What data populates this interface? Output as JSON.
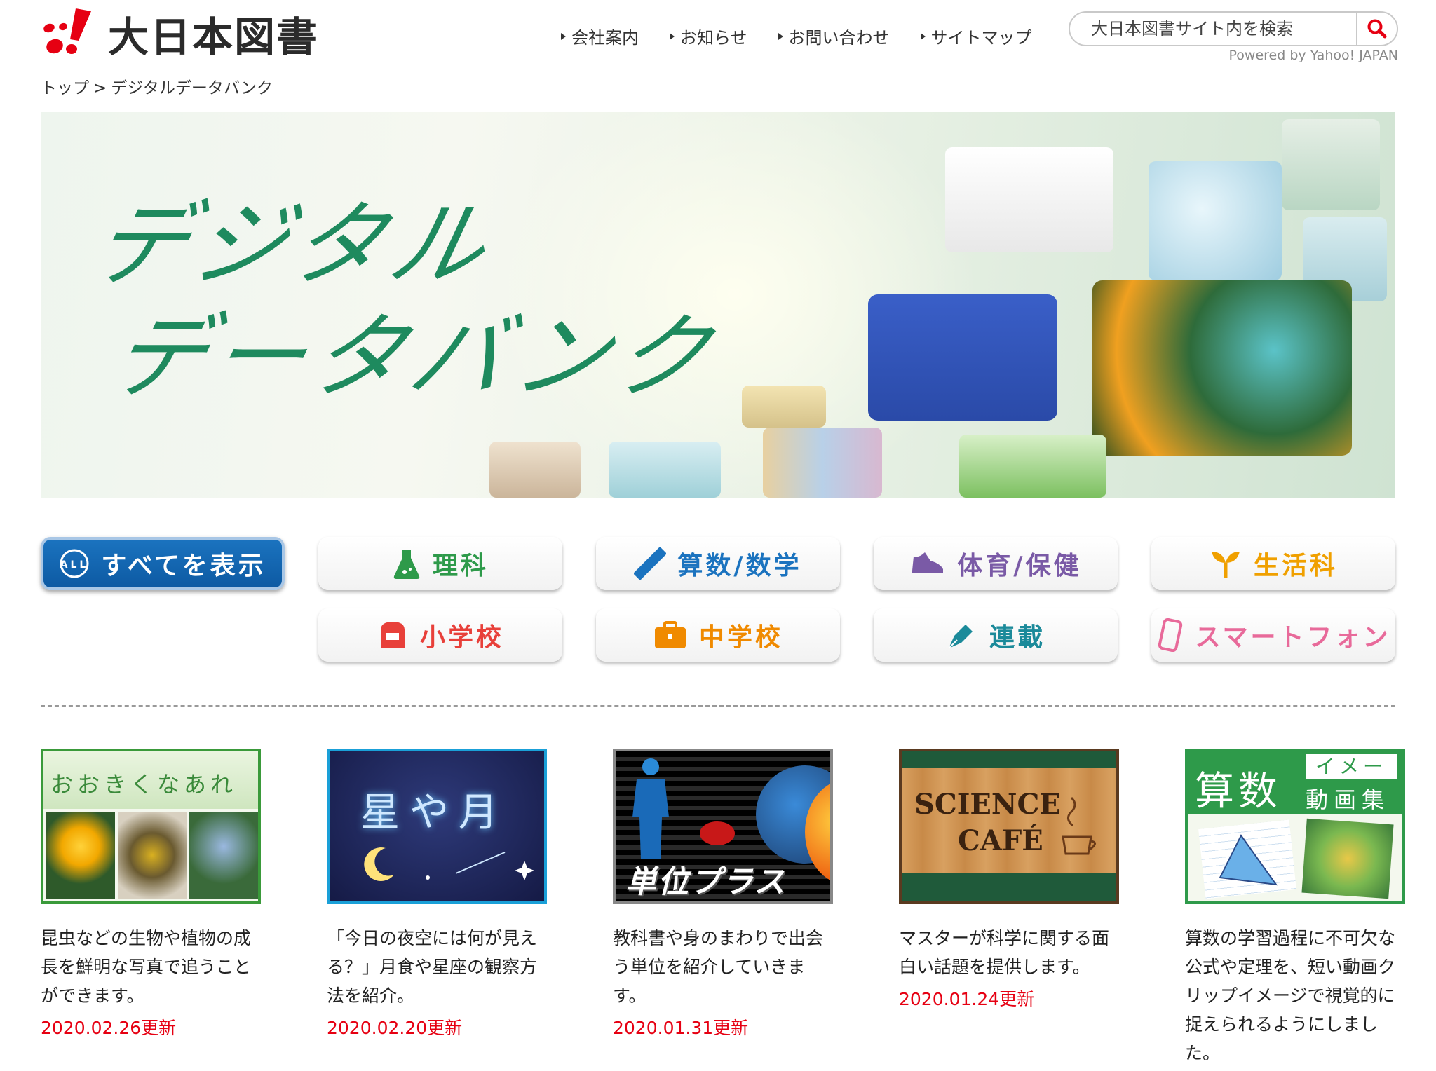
{
  "brand": {
    "name": "大日本図書",
    "color": "#e60012"
  },
  "topnav": [
    {
      "label": "会社案内"
    },
    {
      "label": "お知らせ"
    },
    {
      "label": "お問い合わせ"
    },
    {
      "label": "サイトマップ"
    }
  ],
  "search": {
    "placeholder": "大日本図書サイト内を検索",
    "powered": "Powered by Yahoo! JAPAN"
  },
  "breadcrumb": {
    "home": "トップ",
    "sep": ">",
    "current": "デジタルデータバンク"
  },
  "hero": {
    "line1": "デジタル",
    "line2": "データバンク"
  },
  "categories": [
    {
      "label": "すべてを表示",
      "icon": "all-icon",
      "color": "#0d5aa3"
    },
    {
      "label": "理科",
      "icon": "flask-icon",
      "color": "#2e9a4a"
    },
    {
      "label": "算数/数学",
      "icon": "ruler-icon",
      "color": "#1b73bf"
    },
    {
      "label": "体育/保健",
      "icon": "shoe-icon",
      "color": "#7a5aa6"
    },
    {
      "label": "生活科",
      "icon": "sprout-icon",
      "color": "#f0a000"
    },
    {
      "label": "小学校",
      "icon": "school-bag-icon",
      "color": "#e8403a"
    },
    {
      "label": "中学校",
      "icon": "briefcase-icon",
      "color": "#f08a00"
    },
    {
      "label": "連載",
      "icon": "pen-icon",
      "color": "#1b8a9a"
    },
    {
      "label": "スマートフォン",
      "icon": "smartphone-icon",
      "color": "#e86a9a"
    }
  ],
  "cards": [
    {
      "thumb_title": "おおきくなあれ",
      "desc": "昆虫などの生物や植物の成長を鮮明な写真で追うことができます。",
      "date": "2020.02.26更新"
    },
    {
      "thumb_title": "星や月",
      "desc": "「今日の夜空には何が見える？」月食や星座の観察方法を紹介。",
      "date": "2020.02.20更新"
    },
    {
      "thumb_title": "単位プラス",
      "desc": "教科書や身のまわりで出会う単位を紹介していきます。",
      "date": "2020.01.31更新"
    },
    {
      "thumb_title_1": "SCIENCE",
      "thumb_title_2": "CAFÉ",
      "desc": "マスターが科学に関する面白い話題を提供します。",
      "date": "2020.01.24更新"
    },
    {
      "thumb_title_1": "算数",
      "thumb_title_2": "イメージ",
      "thumb_title_3": "動画集",
      "desc": "算数の学習過程に不可欠な公式や定理を、短い動画クリップイメージで視覚的に捉えられるようにしました。",
      "date": ""
    }
  ]
}
